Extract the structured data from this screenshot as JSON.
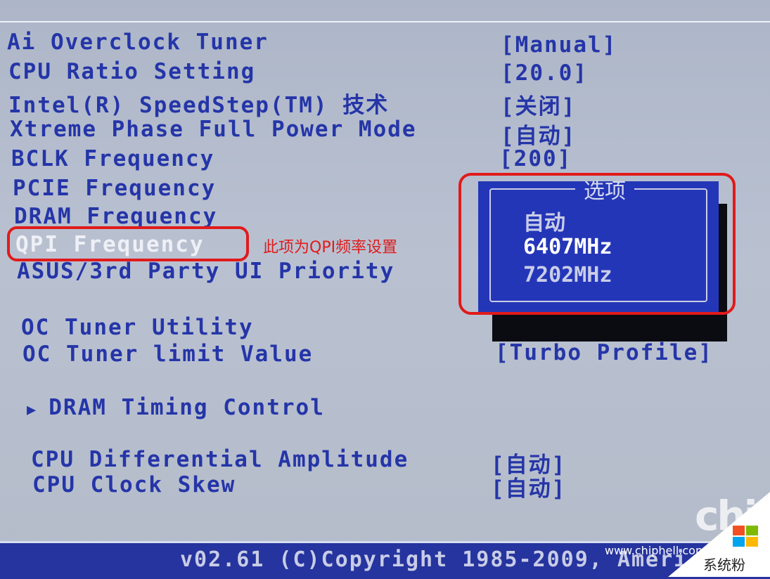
{
  "settings": [
    {
      "label": "Ai Overclock Tuner",
      "value": "[Manual]"
    },
    {
      "label": "CPU Ratio Setting",
      "value": "[20.0]"
    },
    {
      "label": "Intel(R) SpeedStep(TM) 技术",
      "value": "[关闭]"
    },
    {
      "label": "Xtreme Phase Full Power Mode",
      "value": "[自动]"
    },
    {
      "label": "BCLK Frequency",
      "value": "[200]"
    },
    {
      "label": "PCIE Frequency",
      "value": ""
    },
    {
      "label": "DRAM Frequency",
      "value": ""
    },
    {
      "label": "QPI Frequency",
      "value": ""
    },
    {
      "label": "ASUS/3rd Party UI Priority",
      "value": ""
    },
    {
      "label": "OC Tuner Utility",
      "value": ""
    },
    {
      "label": "OC Tuner limit Value",
      "value": "[Turbo Profile]"
    },
    {
      "label": "DRAM Timing Control",
      "value": ""
    },
    {
      "label": "CPU Differential Amplitude",
      "value": "[自动]"
    },
    {
      "label": "CPU Clock Skew",
      "value": "[自动]"
    }
  ],
  "submenu_arrow": "▶",
  "annotation": {
    "text": "此项为QPI频率设置",
    "color": "#e01b1b"
  },
  "popup": {
    "title": "选项",
    "options": [
      "自动",
      "6407MHz",
      "7202MHz"
    ],
    "selected": "6407MHz"
  },
  "footer": {
    "text": "v02.61 (C)Copyright 1985-2009, Ameri"
  },
  "watermark": {
    "chip": "chip",
    "site": "www.chiphell.com",
    "brand": "系统粉",
    "brand_url": "www.win7999.com"
  },
  "colors": {
    "bios_text": "#2535a8",
    "bios_bg": "#b3bccd",
    "popup_bg": "#2436b8",
    "footer_bg": "#25349e"
  }
}
